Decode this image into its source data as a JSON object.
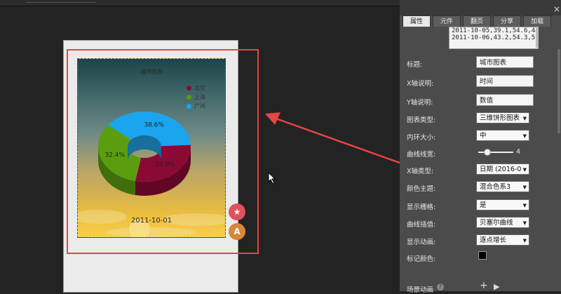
{
  "panel": {
    "close_glyph": "×",
    "tabs": [
      {
        "label": "属性",
        "active": true
      },
      {
        "label": "元件",
        "active": false
      },
      {
        "label": "翻页",
        "active": false
      },
      {
        "label": "分享",
        "active": false
      },
      {
        "label": "加载",
        "active": false
      }
    ],
    "data_lines": [
      "2011-10-05,39.1,54.6,44.2",
      "2011-10-06,43.2,54.3,51.3"
    ],
    "fields": {
      "title_label": "标题:",
      "title_value": "城市图表",
      "xaxis_label": "X轴说明:",
      "xaxis_value": "时间",
      "yaxis_label": "Y轴说明:",
      "yaxis_value": "数值"
    },
    "props": {
      "chart_type_label": "图表类型:",
      "chart_type_value": "三维饼形图表",
      "ring_label": "内环大小:",
      "ring_value": "中",
      "line_width_label": "曲线线宽:",
      "line_width_value": "4",
      "line_width_level": 0.25,
      "xaxis_type_label": "X轴类型:",
      "xaxis_type_value": "日期 (2016-0",
      "theme_label": "颜色主题:",
      "theme_value": "混合色系3",
      "grid_label": "显示栅格:",
      "grid_value": "是",
      "interp_label": "曲线插值:",
      "interp_value": "贝塞尔曲线",
      "anim_label": "显示动画:",
      "anim_value": "逐点增长",
      "marker_label": "标记颜色:",
      "marker_color": "#000000"
    },
    "bottom_label": "场景动画",
    "bottom_plus": "+",
    "bottom_play": "▶"
  },
  "fab": {
    "star_glyph": "★",
    "text_glyph": "A"
  },
  "chart_data": {
    "type": "pie",
    "title": "城市图表",
    "labels": [
      "北京",
      "上海",
      "广州"
    ],
    "values": [
      29.0,
      32.4,
      38.6
    ],
    "data_labels": [
      "29.0%",
      "32.4%",
      "38.6%"
    ],
    "colors": [
      "#8a0a35",
      "#5a9e10",
      "#1aa5ee"
    ],
    "legend_position": "top-right",
    "style": "3d-donut",
    "date_label": "2011-10-01"
  }
}
